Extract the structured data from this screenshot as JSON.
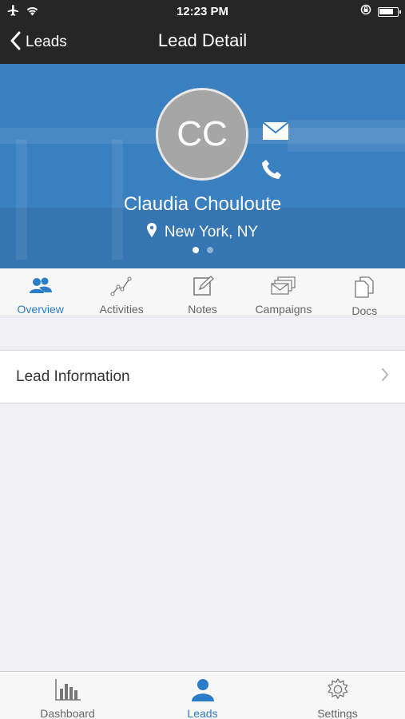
{
  "status_bar": {
    "time": "12:23 PM"
  },
  "nav": {
    "back_label": "Leads",
    "title": "Lead Detail"
  },
  "lead": {
    "initials": "CC",
    "name": "Claudia Chouloute",
    "location": "New York, NY"
  },
  "tabs": [
    {
      "label": "Overview",
      "icon": "people-icon",
      "active": true
    },
    {
      "label": "Activities",
      "icon": "activity-graph-icon",
      "active": false
    },
    {
      "label": "Notes",
      "icon": "note-edit-icon",
      "active": false
    },
    {
      "label": "Campaigns",
      "icon": "mail-stack-icon",
      "active": false
    },
    {
      "label": "Docs",
      "icon": "documents-icon",
      "active": false
    }
  ],
  "rows": [
    {
      "label": "Lead Information"
    }
  ],
  "bottom_tabs": [
    {
      "label": "Dashboard",
      "icon": "bar-chart-icon",
      "active": false
    },
    {
      "label": "Leads",
      "icon": "person-icon",
      "active": true
    },
    {
      "label": "Settings",
      "icon": "gear-icon",
      "active": false
    }
  ],
  "colors": {
    "accent": "#2b7dc8",
    "hero": "#3a7fc0",
    "nav": "#262626"
  }
}
